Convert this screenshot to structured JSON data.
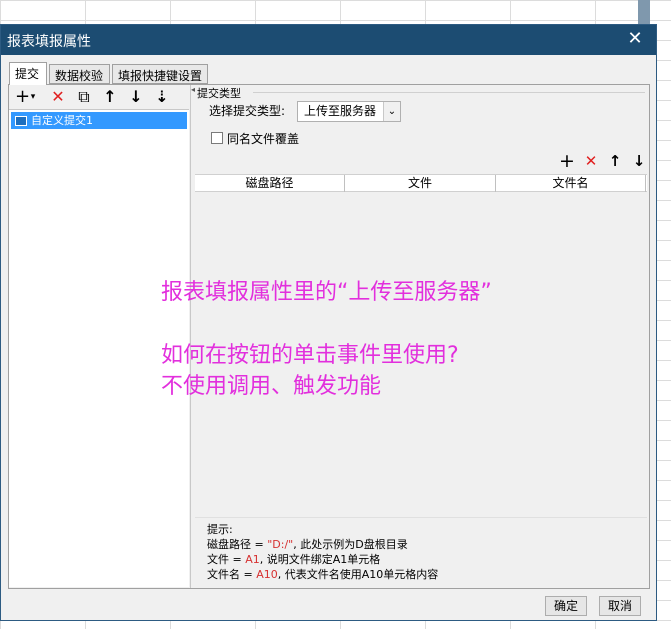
{
  "dialog": {
    "title": "报表填报属性",
    "close_glyph": "✕"
  },
  "tabs": [
    {
      "label": "提交",
      "active": true
    },
    {
      "label": "数据校验",
      "active": false
    },
    {
      "label": "填报快捷键设置",
      "active": false
    }
  ],
  "left_toolbar": {
    "icons": [
      "add-dropdown-icon",
      "delete-icon",
      "copy-icon",
      "move-up-icon",
      "move-down-icon",
      "sort-icon"
    ],
    "add_glyph": "+",
    "add_arrow_glyph": "▾",
    "delete_glyph": "✕",
    "copy_glyph": "⧉",
    "up_glyph": "↑",
    "down_glyph": "↓",
    "sort_glyph": "⇣"
  },
  "left_list": {
    "items": [
      {
        "label": "自定义提交1",
        "selected": true
      }
    ]
  },
  "splitter": {
    "arrow_glyph": "◂"
  },
  "submit_type": {
    "group_label": "提交类型",
    "select_label": "选择提交类型:",
    "selected_value": "上传至服务器",
    "dropdown_glyph": "⌄",
    "checkbox_label": "同名文件覆盖",
    "checkbox_checked": false
  },
  "right_toolbar": {
    "add_glyph": "+",
    "delete_glyph": "✕",
    "up_glyph": "↑",
    "down_glyph": "↓"
  },
  "table": {
    "columns": [
      "磁盘路径",
      "文件",
      "文件名"
    ],
    "rows": []
  },
  "overlay": {
    "line1": "报表填报属性里的“上传至服务器”",
    "line2": "如何在按钮的单击事件里使用?",
    "line3": "不使用调用、触发功能"
  },
  "hint": {
    "title": "提示:",
    "line1_prefix": "磁盘路径 = ",
    "line1_value": "\"D:/\"",
    "line1_suffix": ", 此处示例为D盘根目录",
    "line2_prefix": "文件 = ",
    "line2_value": "A1",
    "line2_suffix": ", 说明文件绑定A1单元格",
    "line3_prefix": "文件名 = ",
    "line3_value": "A10",
    "line3_suffix": ", 代表文件名使用A10单元格内容"
  },
  "footer": {
    "ok_label": "确定",
    "cancel_label": "取消"
  },
  "colors": {
    "titlebar": "#1c4c72",
    "selection": "#3399ff",
    "overlay_text": "#e22fdd",
    "delete_icon": "#e02020",
    "hint_value": "#d63030"
  }
}
